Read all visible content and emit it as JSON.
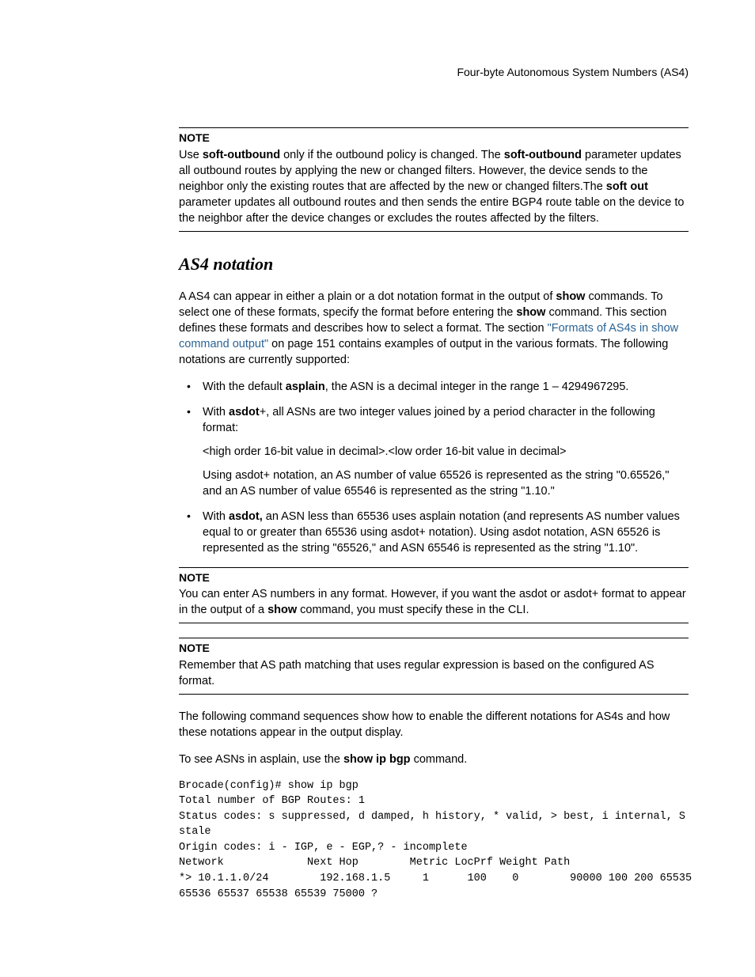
{
  "header": {
    "running": "Four-byte Autonomous System Numbers (AS4)"
  },
  "note1": {
    "label": "NOTE",
    "t1": "Use ",
    "b1": "soft-outbound",
    "t2": " only if the outbound policy is changed. The ",
    "b2": "soft-outbound",
    "t3": " parameter updates all outbound routes by applying the new or changed filters. However, the device sends to the neighbor only the existing routes that are affected by the new or changed filters.The ",
    "b3": "soft out",
    "t4": " parameter updates all outbound routes and then sends the entire BGP4 route table on the device to the neighbor after the device changes or excludes the routes affected by the filters."
  },
  "section": {
    "heading": "AS4 notation",
    "intro_t1": "A AS4 can appear in either a plain or a dot notation format in the output of ",
    "intro_b1": "show",
    "intro_t2": " commands. To select one of these formats, specify the format before entering the ",
    "intro_b2": "show",
    "intro_t3": " command. This section defines these formats and describes how to select a format. The section ",
    "intro_link": "\"Formats of AS4s in show command output\"",
    "intro_t4": " on page 151 contains examples of output in the various formats. The following notations are currently supported:",
    "bullet1_t1": "With the default ",
    "bullet1_b1": "asplain",
    "bullet1_t2": ", the ASN is a decimal integer in the range 1 – 4294967295.",
    "bullet2_t1": "With ",
    "bullet2_b1": "asdot",
    "bullet2_t2": "+, all ASNs are two integer values joined by a period character in the following format:",
    "bullet2_sub1": " <high order 16‑bit value in decimal>.<low order 16‑bit value in decimal>",
    "bullet2_sub2": "Using asdot+ notation, an AS number of value 65526 is represented as the string \"0.65526,\" and an AS number of value 65546 is represented as the string \"1.10.\"",
    "bullet3_t1": "With ",
    "bullet3_b1": "asdot,",
    "bullet3_t2": " an ASN less than 65536 uses asplain notation (and represents AS number values equal to or greater than 65536 using asdot+ notation). Using asdot notation, ASN 65526 is represented as the string \"65526,\" and ASN 65546 is represented as the string \"1.10\"."
  },
  "note2": {
    "label": "NOTE",
    "t1": "You can enter AS numbers in any format. However, if you want the asdot or asdot+ format to appear in the output of a ",
    "b1": "show",
    "t2": " command, you must specify these in the CLI."
  },
  "note3": {
    "label": "NOTE",
    "body": "Remember that AS path matching that uses regular expression is based on the configured AS format."
  },
  "para_following": "The following command sequences show how to enable the different notations for AS4s and how these notations appear in the output display.",
  "para_show_t1": "To see ASNs in asplain, use the ",
  "para_show_b1": "show ip bgp",
  "para_show_t2": " command.",
  "code": "Brocade(config)# show ip bgp\nTotal number of BGP Routes: 1\nStatus codes: s suppressed, d damped, h history, * valid, > best, i internal, S\nstale\nOrigin codes: i - IGP, e - EGP,? - incomplete\nNetwork             Next Hop        Metric LocPrf Weight Path\n*> 10.1.1.0/24        192.168.1.5     1      100    0        90000 100 200 65535\n65536 65537 65538 65539 75000 ?"
}
